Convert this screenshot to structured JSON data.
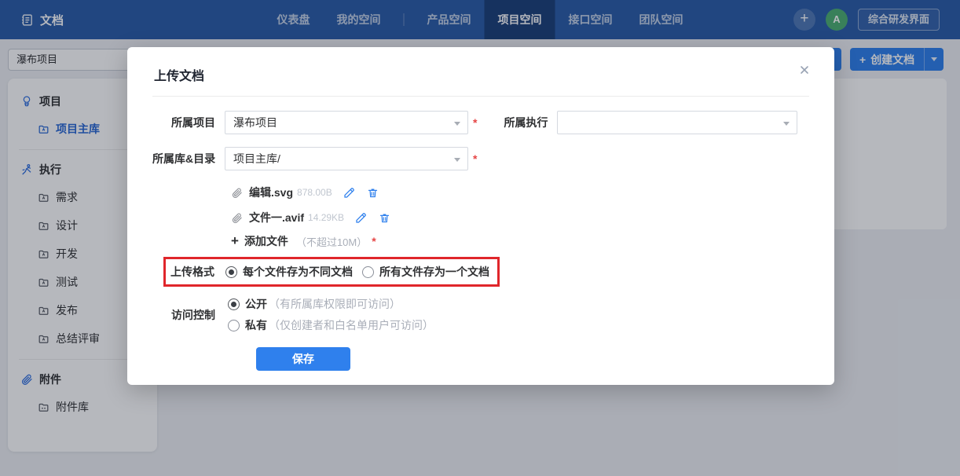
{
  "icons": {
    "plus": "+"
  },
  "colors": {
    "navbar": "#2a5ca8",
    "accent_blue": "#2f80ed",
    "sidebar_active_blue": "#2968d4",
    "avatar_green": "#4caf72",
    "annotation_red": "#e0262b",
    "required_red": "#e64545"
  },
  "navbar": {
    "logo_label": "文档",
    "items": [
      {
        "label": "仪表盘",
        "active": false
      },
      {
        "label": "我的空间",
        "active": false
      },
      {
        "label": "产品空间",
        "active": false
      },
      {
        "label": "项目空间",
        "active": true
      },
      {
        "label": "接口空间",
        "active": false
      },
      {
        "label": "团队空间",
        "active": false
      }
    ],
    "avatar_initial": "A",
    "workspace_button": "综合研发界面"
  },
  "toolbar": {
    "create_doc_label": "创建文档"
  },
  "sidebar": {
    "project_select_value": "瀑布项目",
    "sections": [
      {
        "title": "项目",
        "icon": "balloon-icon",
        "items": [
          {
            "label": "项目主库",
            "active": true
          }
        ]
      },
      {
        "title": "执行",
        "icon": "runner-icon",
        "items": [
          {
            "label": "需求"
          },
          {
            "label": "设计"
          },
          {
            "label": "开发"
          },
          {
            "label": "测试"
          },
          {
            "label": "发布"
          },
          {
            "label": "总结评审"
          }
        ]
      },
      {
        "title": "附件",
        "icon": "paperclip-icon",
        "items": [
          {
            "label": "附件库"
          }
        ]
      }
    ]
  },
  "modal": {
    "title": "上传文档",
    "required_mark": "*",
    "fields": {
      "project": {
        "label": "所属项目",
        "value": "瀑布项目",
        "required": true
      },
      "execution": {
        "label": "所属执行",
        "value": "",
        "required": false
      },
      "lib": {
        "label": "所属库&目录",
        "value": "项目主库/",
        "required": true
      }
    },
    "files": [
      {
        "name": "编辑.svg",
        "size": "878.00B"
      },
      {
        "name": "文件一.avif",
        "size": "14.29KB"
      }
    ],
    "add_file": {
      "label": "添加文件",
      "hint": "（不超过10M）",
      "required": true
    },
    "upload_format": {
      "label": "上传格式",
      "options": [
        {
          "label": "每个文件存为不同文档",
          "selected": true
        },
        {
          "label": "所有文件存为一个文档",
          "selected": false
        }
      ]
    },
    "access": {
      "label": "访问控制",
      "options": [
        {
          "name": "公开",
          "desc": "（有所属库权限即可访问）",
          "selected": true
        },
        {
          "name": "私有",
          "desc": "（仅创建者和白名单用户可访问）",
          "selected": false
        }
      ]
    },
    "save_label": "保存"
  }
}
